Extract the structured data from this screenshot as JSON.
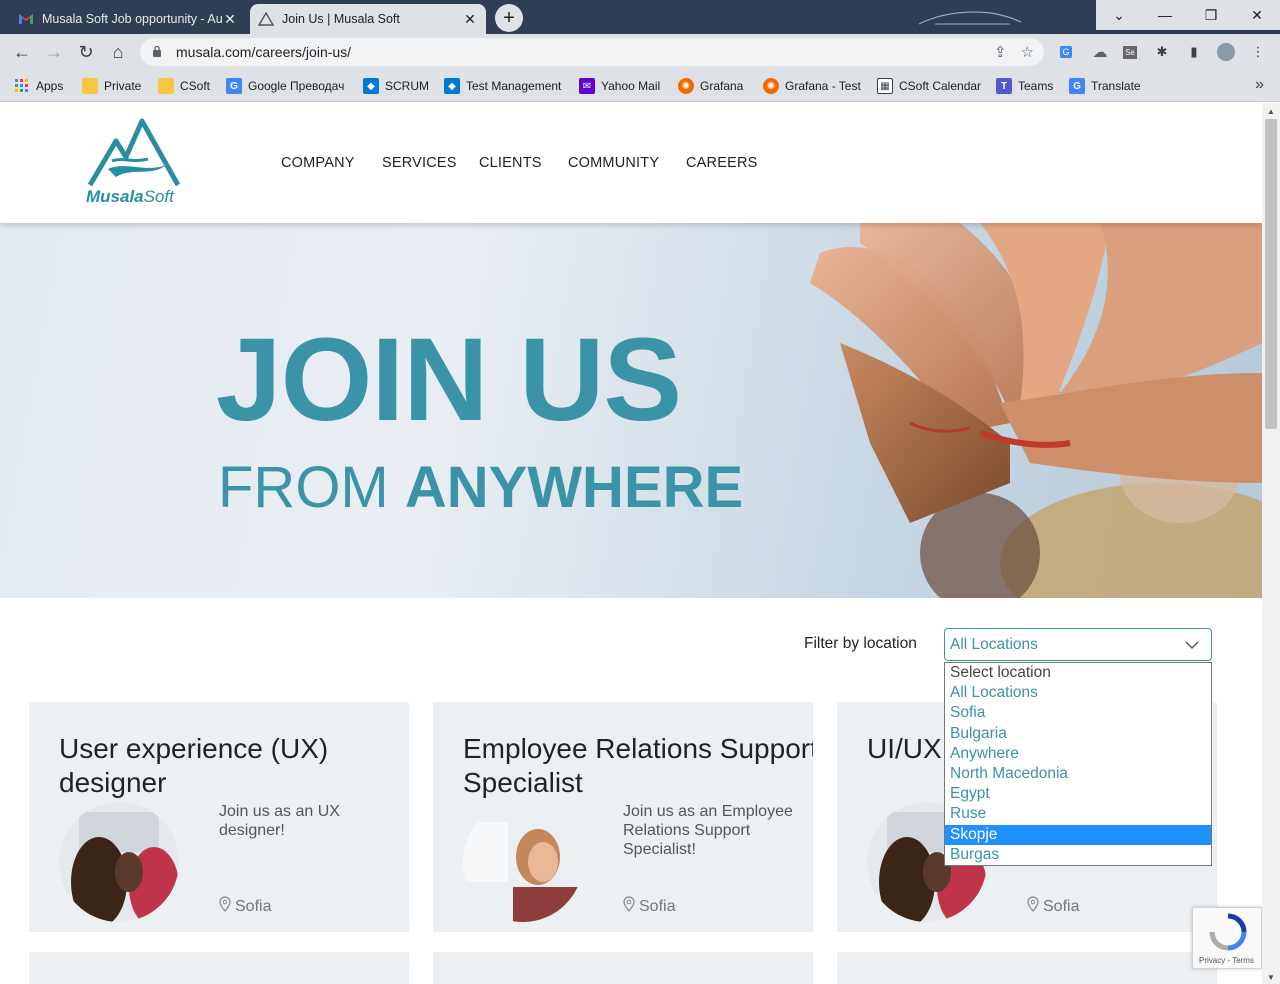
{
  "browser": {
    "tabs": [
      {
        "title": "Musala Soft Job opportunity - Au",
        "icon": "gmail-icon",
        "active": false
      },
      {
        "title": "Join Us | Musala Soft",
        "icon": "musala-favicon",
        "active": true
      }
    ],
    "url": "musala.com/careers/join-us/",
    "bookmarks": [
      {
        "label": "Apps",
        "icon": "apps-grid-icon"
      },
      {
        "label": "Private",
        "icon": "folder-icon"
      },
      {
        "label": "CSoft",
        "icon": "folder-icon"
      },
      {
        "label": "Google Преводач",
        "icon": "google-translate-icon"
      },
      {
        "label": "SCRUM",
        "icon": "azure-devops-icon"
      },
      {
        "label": "Test Management",
        "icon": "azure-devops-icon"
      },
      {
        "label": "Yahoo Mail",
        "icon": "yahoo-mail-icon"
      },
      {
        "label": "Grafana",
        "icon": "grafana-icon"
      },
      {
        "label": "Grafana - Test",
        "icon": "grafana-icon"
      },
      {
        "label": "CSoft Calendar",
        "icon": "calendar-icon"
      },
      {
        "label": "Teams",
        "icon": "teams-icon"
      },
      {
        "label": "Translate",
        "icon": "google-translate-icon"
      }
    ]
  },
  "site": {
    "logo_brand": "Musala",
    "logo_suffix": "Soft",
    "nav": [
      "COMPANY",
      "SERVICES",
      "CLIENTS",
      "COMMUNITY",
      "CAREERS"
    ],
    "hero": {
      "title": "JOIN US",
      "sub_prefix": "FROM ",
      "sub_bold": "ANYWHERE"
    },
    "filter": {
      "label": "Filter by location",
      "value": "All Locations",
      "options": [
        "Select location",
        "All Locations",
        "Sofia",
        "Bulgaria",
        "Anywhere",
        "North Macedonia",
        "Egypt",
        "Ruse",
        "Skopje",
        "Burgas"
      ],
      "highlighted": "Skopje"
    },
    "jobs": [
      {
        "title": "User experience (UX) designer",
        "description": "Join us as an UX designer!",
        "location": "Sofia"
      },
      {
        "title": "Employee Relations Support Specialist",
        "description": "Join us as an Employee Relations Support Specialist!",
        "location": "Sofia"
      },
      {
        "title": "UI/UX",
        "description": "",
        "location": "Sofia"
      }
    ],
    "recaptcha": {
      "text": "Privacy - Terms"
    }
  },
  "colors": {
    "accent": "#3b93a7",
    "chrome_dark": "#2f3e52",
    "chrome_light": "#dee1e6",
    "card_bg": "#edf0f3",
    "selected_option": "#1e90ff"
  }
}
